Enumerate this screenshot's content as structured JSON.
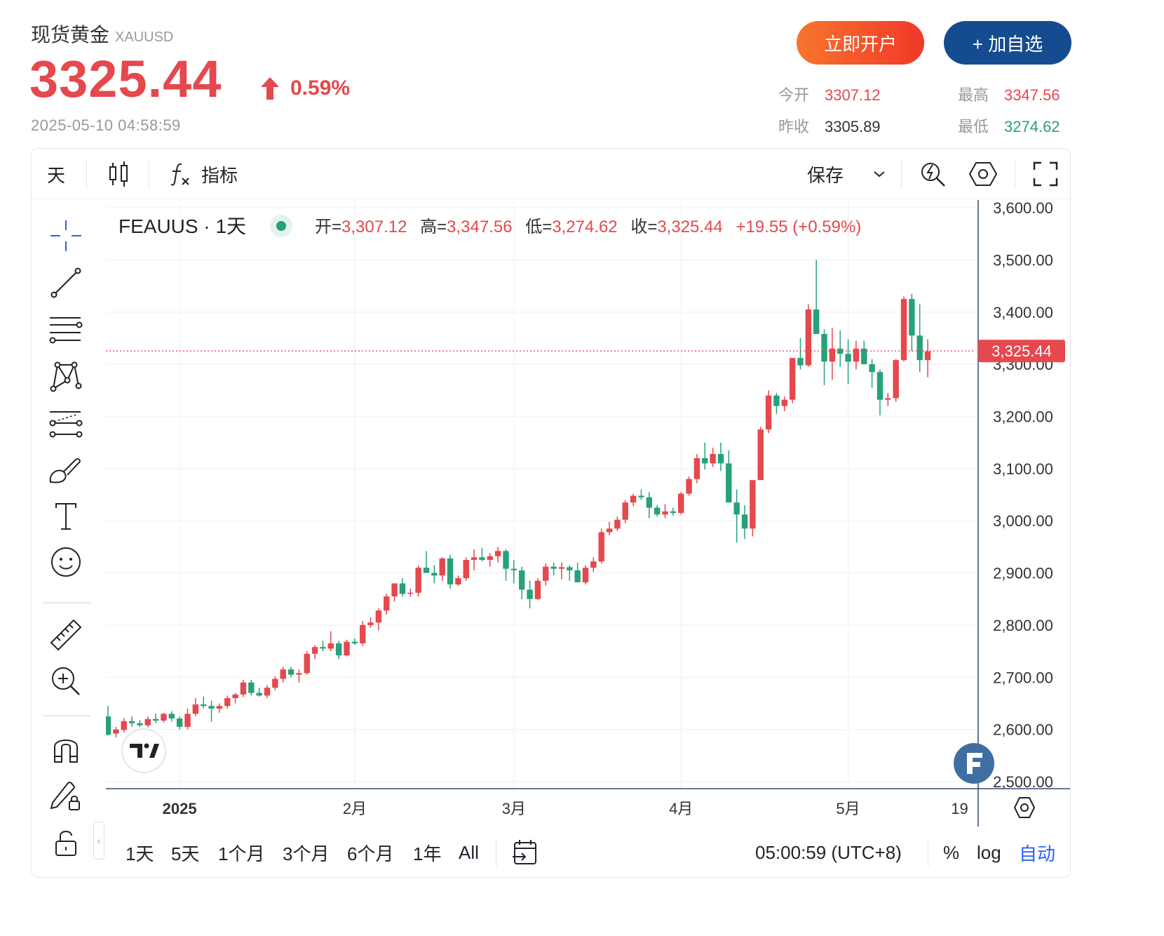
{
  "header": {
    "name": "现货黄金",
    "symbol": "XAUUSD",
    "price": "3325.44",
    "change_pct": "0.59%",
    "timestamp": "2025-05-10 04:58:59",
    "open_account_label": "立即开户",
    "add_watch_label": "+ 加自选",
    "stats": {
      "open_label": "今开",
      "open_value": "3307.12",
      "high_label": "最高",
      "high_value": "3347.56",
      "prev_close_label": "昨收",
      "prev_close_value": "3305.89",
      "low_label": "最低",
      "low_value": "3274.62"
    }
  },
  "toolbar": {
    "interval": "天",
    "indicators_label": "指标",
    "save_label": "保存"
  },
  "legend": {
    "title": "FEAUUS · 1天",
    "open_label": "开=",
    "open_value": "3,307.12",
    "high_label": "高=",
    "high_value": "3,347.56",
    "low_label": "低=",
    "low_value": "3,274.62",
    "close_label": "收=",
    "close_value": "3,325.44",
    "change": "+19.55 (+0.59%)"
  },
  "bottom": {
    "ranges": [
      "1天",
      "5天",
      "1个月",
      "3个月",
      "6个月",
      "1年",
      "All"
    ],
    "time": "05:00:59 (UTC+8)",
    "percent_label": "%",
    "log_label": "log",
    "auto_label": "自动"
  },
  "colors": {
    "up": "#e5484d",
    "down": "#26a17b",
    "accent": "#2962ff",
    "brand_blue": "#154c8f"
  },
  "icons": {
    "crosshair": "crosshair-icon",
    "trendline": "trend-line-icon",
    "fib": "fib-retracement-icon",
    "pattern": "pattern-icon",
    "projection": "projection-icon",
    "brush": "brush-icon",
    "text": "text-icon",
    "emoji": "emoji-icon",
    "ruler": "ruler-icon",
    "zoom": "zoom-in-icon",
    "magnet": "magnet-icon",
    "lock_pencil": "lock-drawing-icon",
    "lock": "lock-icon"
  },
  "chart_data": {
    "type": "candlestick",
    "interval": "1天",
    "last_price_label": "3,325.44",
    "y_ticks": [
      "3,600.00",
      "3,500.00",
      "3,400.00",
      "3,300.00",
      "3,200.00",
      "3,100.00",
      "3,000.00",
      "2,900.00",
      "2,800.00",
      "2,700.00",
      "2,600.00",
      "2,500.00"
    ],
    "x_ticks": [
      {
        "label": "2025",
        "index": 9
      },
      {
        "label": "2月",
        "index": 31
      },
      {
        "label": "3月",
        "index": 51
      },
      {
        "label": "4月",
        "index": 72
      },
      {
        "label": "5月",
        "index": 93
      },
      {
        "label": "19",
        "index": 107
      }
    ],
    "ylim": [
      2495,
      3605
    ],
    "candles": [
      [
        2625,
        2645,
        2588,
        2590
      ],
      [
        2592,
        2605,
        2585,
        2600
      ],
      [
        2599,
        2622,
        2594,
        2616
      ],
      [
        2616,
        2625,
        2605,
        2612
      ],
      [
        2612,
        2618,
        2605,
        2608
      ],
      [
        2608,
        2625,
        2604,
        2620
      ],
      [
        2620,
        2630,
        2612,
        2617
      ],
      [
        2617,
        2632,
        2613,
        2630
      ],
      [
        2630,
        2635,
        2615,
        2621
      ],
      [
        2621,
        2625,
        2600,
        2605
      ],
      [
        2605,
        2640,
        2600,
        2630
      ],
      [
        2630,
        2660,
        2625,
        2648
      ],
      [
        2648,
        2663,
        2640,
        2645
      ],
      [
        2645,
        2655,
        2615,
        2640
      ],
      [
        2640,
        2650,
        2632,
        2645
      ],
      [
        2645,
        2665,
        2640,
        2660
      ],
      [
        2660,
        2670,
        2650,
        2667
      ],
      [
        2667,
        2695,
        2662,
        2690
      ],
      [
        2690,
        2695,
        2665,
        2670
      ],
      [
        2670,
        2680,
        2663,
        2665
      ],
      [
        2665,
        2685,
        2660,
        2680
      ],
      [
        2680,
        2702,
        2675,
        2697
      ],
      [
        2697,
        2720,
        2690,
        2715
      ],
      [
        2715,
        2720,
        2700,
        2705
      ],
      [
        2705,
        2715,
        2690,
        2708
      ],
      [
        2708,
        2750,
        2705,
        2745
      ],
      [
        2745,
        2762,
        2735,
        2758
      ],
      [
        2758,
        2770,
        2750,
        2755
      ],
      [
        2755,
        2788,
        2750,
        2765
      ],
      [
        2765,
        2770,
        2735,
        2742
      ],
      [
        2742,
        2772,
        2740,
        2768
      ],
      [
        2768,
        2775,
        2762,
        2765
      ],
      [
        2765,
        2808,
        2760,
        2800
      ],
      [
        2800,
        2815,
        2795,
        2805
      ],
      [
        2805,
        2832,
        2790,
        2828
      ],
      [
        2828,
        2860,
        2820,
        2855
      ],
      [
        2855,
        2880,
        2845,
        2880
      ],
      [
        2880,
        2890,
        2855,
        2860
      ],
      [
        2860,
        2870,
        2855,
        2862
      ],
      [
        2862,
        2915,
        2855,
        2910
      ],
      [
        2910,
        2942,
        2900,
        2900
      ],
      [
        2900,
        2915,
        2880,
        2895
      ],
      [
        2895,
        2930,
        2885,
        2928
      ],
      [
        2928,
        2935,
        2870,
        2878
      ],
      [
        2878,
        2895,
        2875,
        2890
      ],
      [
        2890,
        2930,
        2885,
        2925
      ],
      [
        2925,
        2945,
        2905,
        2930
      ],
      [
        2930,
        2948,
        2922,
        2925
      ],
      [
        2925,
        2938,
        2912,
        2932
      ],
      [
        2932,
        2950,
        2920,
        2942
      ],
      [
        2942,
        2945,
        2885,
        2908
      ],
      [
        2908,
        2925,
        2880,
        2905
      ],
      [
        2905,
        2912,
        2850,
        2868
      ],
      [
        2868,
        2885,
        2832,
        2850
      ],
      [
        2850,
        2890,
        2848,
        2885
      ],
      [
        2885,
        2918,
        2876,
        2912
      ],
      [
        2912,
        2920,
        2895,
        2908
      ],
      [
        2908,
        2920,
        2888,
        2911
      ],
      [
        2911,
        2915,
        2885,
        2905
      ],
      [
        2905,
        2920,
        2882,
        2882
      ],
      [
        2882,
        2915,
        2878,
        2910
      ],
      [
        2910,
        2930,
        2902,
        2922
      ],
      [
        2922,
        2985,
        2918,
        2978
      ],
      [
        2978,
        2998,
        2972,
        2985
      ],
      [
        2985,
        3008,
        2980,
        3002
      ],
      [
        3002,
        3040,
        2995,
        3035
      ],
      [
        3035,
        3052,
        3028,
        3048
      ],
      [
        3048,
        3060,
        3040,
        3045
      ],
      [
        3045,
        3055,
        3005,
        3025
      ],
      [
        3025,
        3030,
        3008,
        3012
      ],
      [
        3012,
        3032,
        3005,
        3018
      ],
      [
        3018,
        3025,
        3010,
        3015
      ],
      [
        3015,
        3055,
        3012,
        3052
      ],
      [
        3052,
        3085,
        3048,
        3080
      ],
      [
        3080,
        3128,
        3072,
        3120
      ],
      [
        3120,
        3150,
        3098,
        3110
      ],
      [
        3110,
        3140,
        3103,
        3128
      ],
      [
        3128,
        3150,
        3095,
        3110
      ],
      [
        3110,
        3135,
        3050,
        3035
      ],
      [
        3035,
        3060,
        2958,
        3012
      ],
      [
        3012,
        3030,
        2965,
        2985
      ],
      [
        2985,
        3052,
        2970,
        3078
      ],
      [
        3078,
        3180,
        3082,
        3175
      ],
      [
        3175,
        3250,
        3168,
        3240
      ],
      [
        3240,
        3245,
        3205,
        3220
      ],
      [
        3220,
        3238,
        3210,
        3232
      ],
      [
        3232,
        3295,
        3225,
        3312
      ],
      [
        3312,
        3350,
        3290,
        3298
      ],
      [
        3298,
        3415,
        3295,
        3405
      ],
      [
        3405,
        3500,
        3360,
        3358
      ],
      [
        3358,
        3367,
        3260,
        3305
      ],
      [
        3305,
        3370,
        3270,
        3330
      ],
      [
        3330,
        3365,
        3295,
        3320
      ],
      [
        3320,
        3348,
        3262,
        3305
      ],
      [
        3305,
        3345,
        3290,
        3330
      ],
      [
        3330,
        3345,
        3302,
        3300
      ],
      [
        3300,
        3310,
        3255,
        3285
      ],
      [
        3285,
        3290,
        3202,
        3232
      ],
      [
        3232,
        3245,
        3220,
        3235
      ],
      [
        3235,
        3310,
        3228,
        3308
      ],
      [
        3308,
        3430,
        3305,
        3425
      ],
      [
        3425,
        3435,
        3325,
        3355
      ],
      [
        3355,
        3415,
        3285,
        3308
      ],
      [
        3308,
        3348,
        3275,
        3325
      ]
    ]
  }
}
